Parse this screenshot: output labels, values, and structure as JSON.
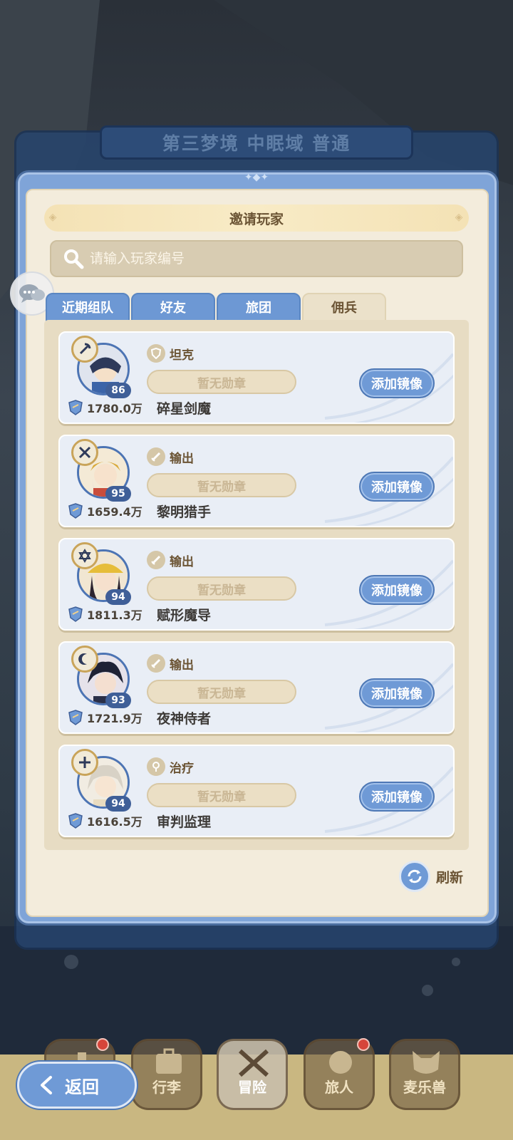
{
  "header": {
    "stage_title": "第三梦境 中眠域 普通"
  },
  "dialog": {
    "title": "邀请玩家",
    "search": {
      "placeholder": "请输入玩家编号"
    },
    "tabs": [
      {
        "label": "近期组队"
      },
      {
        "label": "好友"
      },
      {
        "label": "旅团"
      },
      {
        "label": "佣兵",
        "active": true
      }
    ],
    "mercenaries": [
      {
        "name": "碎星剑魔",
        "role": "坦克",
        "level": "86",
        "power": "1780.0万",
        "medal": "暂无勋章",
        "action": "添加镜像",
        "role_icon": "shield-icon"
      },
      {
        "name": "黎明猎手",
        "role": "输出",
        "level": "95",
        "power": "1659.4万",
        "medal": "暂无勋章",
        "action": "添加镜像",
        "role_icon": "sword-icon"
      },
      {
        "name": "赋形魔导",
        "role": "输出",
        "level": "94",
        "power": "1811.3万",
        "medal": "暂无勋章",
        "action": "添加镜像",
        "role_icon": "sword-icon"
      },
      {
        "name": "夜神侍者",
        "role": "输出",
        "level": "93",
        "power": "1721.9万",
        "medal": "暂无勋章",
        "action": "添加镜像",
        "role_icon": "sword-icon"
      },
      {
        "name": "审判监理",
        "role": "治疗",
        "level": "94",
        "power": "1616.5万",
        "medal": "暂无勋章",
        "action": "添加镜像",
        "role_icon": "heal-icon"
      }
    ],
    "refresh_label": "刷新"
  },
  "bottom_nav": {
    "back_label": "返回",
    "items": [
      {
        "label": "行李"
      },
      {
        "label": "冒险",
        "active": true
      },
      {
        "label": "旅人"
      },
      {
        "label": "麦乐兽"
      }
    ]
  },
  "colors": {
    "accent_blue": "#6f9ad6",
    "panel_cream": "#f3ecdc",
    "text_brown": "#6b5434"
  }
}
